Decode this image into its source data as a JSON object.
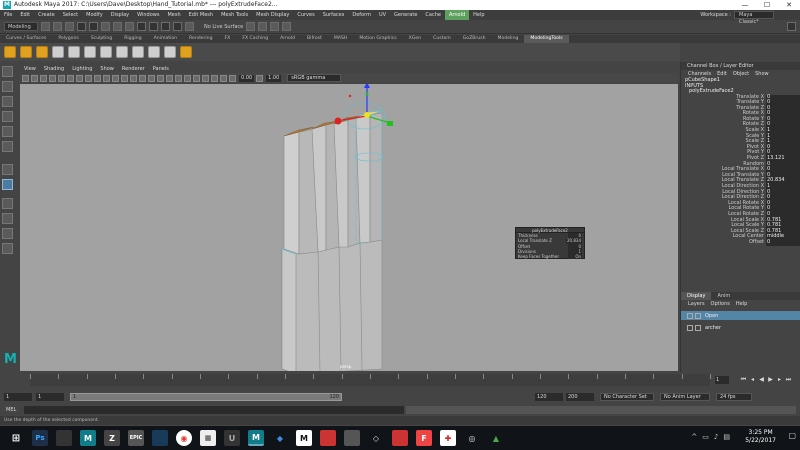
{
  "titlebar": {
    "title": "Autodesk Maya 2017: C:\\Users\\Dave\\Desktop\\Hand_Tutorial.mb*   ---   polyExtrudeFace2...",
    "min": "—",
    "max": "☐",
    "close": "✕"
  },
  "menubar": {
    "items": [
      "File",
      "Edit",
      "Create",
      "Select",
      "Modify",
      "Display",
      "Windows",
      "Mesh",
      "Edit Mesh",
      "Mesh Tools",
      "Mesh Display",
      "Curves",
      "Surfaces",
      "Deform",
      "UV",
      "Generate",
      "Cache",
      "Arnold",
      "Help"
    ],
    "highlighted": "Arnold",
    "workspace_label": "Workspace :",
    "workspace_value": "Maya Classic*"
  },
  "statusline": {
    "mode": "Modeling",
    "symmetry": "No Live Surface"
  },
  "shelftabs": {
    "items": [
      "Curves / Surfaces",
      "Polygons",
      "Sculpting",
      "Rigging",
      "Animation",
      "Rendering",
      "FX",
      "FX Caching",
      "Arnold",
      "Bifrost",
      "MASH",
      "Motion Graphics",
      "XGen",
      "Custom",
      "GoZBrush",
      "Modeling",
      "ModelingTools"
    ],
    "active": "ModelingTools"
  },
  "viewport": {
    "menu": [
      "View",
      "Shading",
      "Lighting",
      "Show",
      "Renderer",
      "Panels"
    ],
    "val1": "0.00",
    "val2": "1.00",
    "colorspace": "sRGB gamma",
    "camera": "persp"
  },
  "popup": {
    "title": "polyExtrudeFace2",
    "rows": [
      {
        "label": "Thickness",
        "value": "0"
      },
      {
        "label": "Local Translate Z",
        "value": "20.834"
      },
      {
        "label": "Offset",
        "value": "0"
      },
      {
        "label": "Divisions",
        "value": "1"
      },
      {
        "label": "Keep Faces Together",
        "value": "On"
      }
    ]
  },
  "channelbox": {
    "title": "Channel Box / Layer Editor",
    "menu": [
      "Channels",
      "Edit",
      "Object",
      "Show"
    ],
    "shape": "pCubeShape1",
    "inputs_label": "INPUTS",
    "input_node": "polyExtrudeFace2",
    "attrs": [
      {
        "n": "Translate X",
        "v": "0"
      },
      {
        "n": "Translate Y",
        "v": "0"
      },
      {
        "n": "Translate Z",
        "v": "0"
      },
      {
        "n": "Rotate X",
        "v": "0"
      },
      {
        "n": "Rotate Y",
        "v": "0"
      },
      {
        "n": "Rotate Z",
        "v": "0"
      },
      {
        "n": "Scale X",
        "v": "1"
      },
      {
        "n": "Scale Y",
        "v": "1"
      },
      {
        "n": "Scale Z",
        "v": "1"
      },
      {
        "n": "Pivot X",
        "v": "0"
      },
      {
        "n": "Pivot Y",
        "v": "0"
      },
      {
        "n": "Pivot Z",
        "v": "13.121"
      },
      {
        "n": "Random",
        "v": "0"
      },
      {
        "n": "Local Translate X",
        "v": "0"
      },
      {
        "n": "Local Translate Y",
        "v": "0"
      },
      {
        "n": "Local Translate Z",
        "v": "20.834"
      },
      {
        "n": "Local Direction X",
        "v": "1"
      },
      {
        "n": "Local Direction Y",
        "v": "0"
      },
      {
        "n": "Local Direction Z",
        "v": "0"
      },
      {
        "n": "Local Rotate X",
        "v": "0"
      },
      {
        "n": "Local Rotate Y",
        "v": "0"
      },
      {
        "n": "Local Rotate Z",
        "v": "0"
      },
      {
        "n": "Local Scale X",
        "v": "0.781"
      },
      {
        "n": "Local Scale Y",
        "v": "0.781"
      },
      {
        "n": "Local Scale Z",
        "v": "0.781"
      },
      {
        "n": "Local Center",
        "v": "middle"
      },
      {
        "n": "Offset",
        "v": "0"
      }
    ]
  },
  "layers": {
    "tabs": [
      "Display",
      "Anim"
    ],
    "menu": [
      "Layers",
      "Options",
      "Help"
    ],
    "items": [
      {
        "name": "Open"
      },
      {
        "name": "archer"
      }
    ]
  },
  "timeslider": {
    "current": "1"
  },
  "rangeslider": {
    "start": "1",
    "inner_start": "1",
    "bar_start": "1",
    "bar_end": "120",
    "end": "120",
    "outer_end": "200",
    "character_set": "No Character Set",
    "anim_layer": "No Anim Layer",
    "fps": "24 fps"
  },
  "cmdline": {
    "label": "MEL"
  },
  "helpline": {
    "text": "Use the depth of the selected component."
  },
  "taskbar": {
    "time": "3:25 PM",
    "date": "5/22/2017"
  },
  "colors": {
    "accent": "#5285a6",
    "viewport_bg": "#a2a2a2",
    "arnold_highlight": "#5ea05e"
  }
}
